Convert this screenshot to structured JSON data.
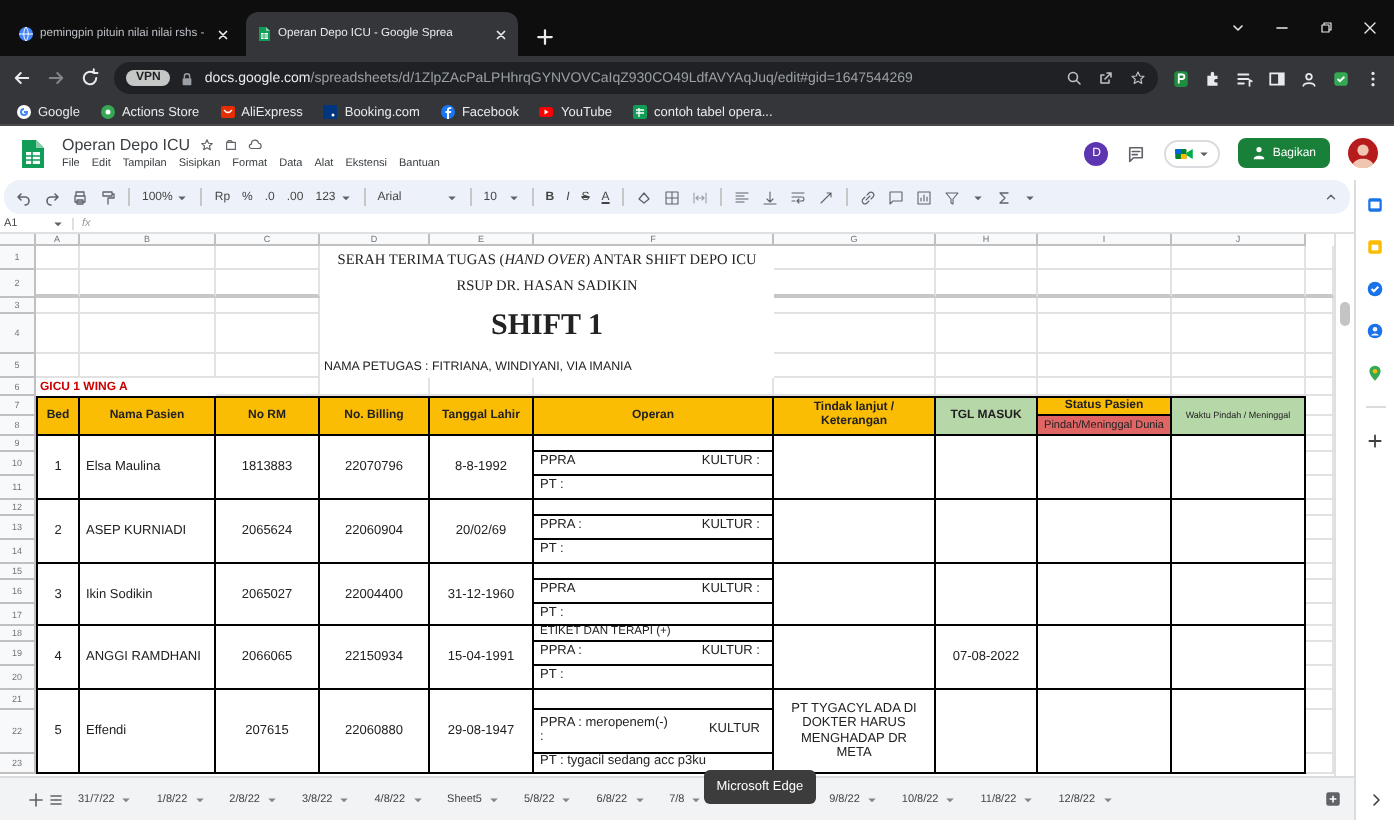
{
  "browser": {
    "tabs": [
      {
        "title": "pemingpin pituin nilai nilai rshs -",
        "selected": false
      },
      {
        "title": "Operan Depo ICU - Google Sprea",
        "selected": true
      }
    ],
    "chip": "VPN",
    "url_host": "docs.google.com",
    "url_path": "/spreadsheets/d/1ZlpZAcPaLPHhrqGYNVOVCaIqZ930CO49LdfAVYAqJuq/edit#gid=1647544269",
    "bookmarks": [
      "Google",
      "Actions Store",
      "AliExpress",
      "Booking.com",
      "Facebook",
      "YouTube",
      "contoh tabel opera..."
    ]
  },
  "app": {
    "title": "Operan Depo ICU",
    "menus": [
      "File",
      "Edit",
      "Tampilan",
      "Sisipkan",
      "Format",
      "Data",
      "Alat",
      "Ekstensi",
      "Bantuan"
    ],
    "user_initial": "D",
    "share": "Bagikan"
  },
  "toolbar": {
    "zoom": "100%",
    "currency": "Rp",
    "percent": "%",
    "decimal_less": ".0",
    "decimal_more": ".00",
    "number_format": "123",
    "font": "Arial",
    "font_size": "10",
    "bold": "B",
    "italic": "I",
    "strike": "S",
    "text_color": "A"
  },
  "formula_bar": {
    "name_box": "A1",
    "fx": "fx"
  },
  "sheet": {
    "column_letters": [
      "A",
      "B",
      "C",
      "D",
      "E",
      "F",
      "G",
      "H",
      "I",
      "J"
    ],
    "row_numbers": [
      "1",
      "2",
      "3",
      "4",
      "5",
      "6",
      "7",
      "8",
      "9",
      "10",
      "11",
      "12",
      "13",
      "14",
      "15",
      "16",
      "17",
      "18",
      "19",
      "20",
      "21",
      "22",
      "23"
    ],
    "title": "SERAH TERIMA TUGAS (*HAND OVER*) ANTAR SHIFT DEPO ICU",
    "subtitle": "RSUP DR. HASAN SADIKIN",
    "shift": "SHIFT 1",
    "staff": "NAMA PETUGAS : FITRIANA, WINDIYANI, VIA IMANIA",
    "ward": "GICU 1 WING A",
    "headers": [
      {
        "text": "Bed",
        "color": "#fbbc04"
      },
      {
        "text": "Nama Pasien",
        "color": "#fbbc04"
      },
      {
        "text": "No RM",
        "color": "#fbbc04"
      },
      {
        "text": "No. Billing",
        "color": "#fbbc04"
      },
      {
        "text": "Tanggal Lahir",
        "color": "#fbbc04"
      },
      {
        "text": "Operan",
        "color": "#fbbc04"
      },
      {
        "text": "Tindak lanjut / Keterangan",
        "color": "#fbbc04"
      },
      {
        "text": "TGL MASUK",
        "color": "#b6d7a8"
      },
      {
        "text": "Status Pasien",
        "color": "#fbbc04",
        "sub": {
          "text": "Pindah/Meninggal Dunia",
          "color": "#e06666"
        }
      },
      {
        "text": "Waktu Pindah / Meninggal",
        "color": "#b6d7a8"
      }
    ],
    "patients": [
      {
        "bed": "1",
        "name": "Elsa Maulina",
        "rm": "1813883",
        "billing": "22070796",
        "birth_date": "8-8-1992",
        "operan": {
          "ppra": "PPRA",
          "kultur": "KULTUR :",
          "pt": "PT :"
        }
      },
      {
        "bed": "2",
        "name": "ASEP KURNIADI",
        "rm": "2065624",
        "billing": "22060904",
        "birth_date": "20/02/69",
        "operan": {
          "ppra": "PPRA :",
          "kultur": "KULTUR :",
          "pt": "PT :"
        }
      },
      {
        "bed": "3",
        "name": "Ikin Sodikin",
        "rm": "2065027",
        "billing": "22004400",
        "birth_date": "31-12-1960",
        "operan": {
          "ppra": "PPRA",
          "kultur": "KULTUR :",
          "pt": "PT :"
        }
      },
      {
        "bed": "4",
        "name": "ANGGI RAMDHANI",
        "rm": "2066065",
        "billing": "22150934",
        "birth_date": "15-04-1991",
        "operan": {
          "note": "ETIKET DAN TERAPI (+)",
          "ppra": "PPRA :",
          "kultur": "KULTUR :",
          "pt": "PT :"
        },
        "admitted": "07-08-2022"
      },
      {
        "bed": "5",
        "name": "Effendi",
        "rm": "207615",
        "billing": "22060880",
        "birth_date": "29-08-1947",
        "operan": {
          "ppra": "PPRA : meropenem(-)\n:",
          "kultur": "KULTUR",
          "pt": "PT : tygacil sedang acc p3ku"
        },
        "follow_up": "PT TYGACYL ADA DI DOKTER HARUS MENGHADAP DR META"
      }
    ]
  },
  "sheet_tabs": [
    "31/7/22",
    "1/8/22",
    "2/8/22",
    "3/8/22",
    "4/8/22",
    "Sheet5",
    "5/8/22",
    "6/8/22",
    "7/8",
    "9/8/22",
    "10/8/22",
    "11/8/22",
    "12/8/22"
  ],
  "tooltip": "Microsoft Edge"
}
